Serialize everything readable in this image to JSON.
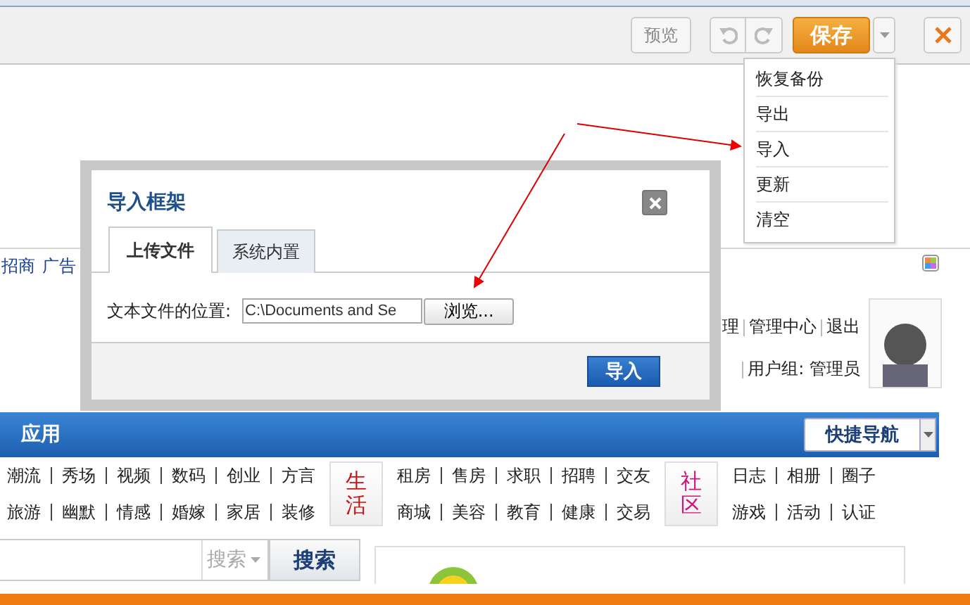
{
  "toolbar": {
    "preview_button": "预览",
    "save_button": "保存"
  },
  "menu": {
    "items": [
      {
        "label": "恢复备份"
      },
      {
        "label": "导出"
      },
      {
        "label": "导入"
      },
      {
        "label": "更新"
      },
      {
        "label": "清空"
      }
    ]
  },
  "header_links": [
    "招商",
    "广告"
  ],
  "user_links": [
    "理",
    "管理中心",
    "退出"
  ],
  "user_group": "用户组: 管理员",
  "nav": {
    "title": "应用",
    "quick_nav": "快捷导航"
  },
  "categories": [
    {
      "kind": "links",
      "rows": [
        [
          "潮流",
          "秀场",
          "视频",
          "数码",
          "创业",
          "方言"
        ],
        [
          "旅游",
          "幽默",
          "情感",
          "婚嫁",
          "家居",
          "装修"
        ]
      ]
    },
    {
      "kind": "tag",
      "label": "生活",
      "color": "#cc1111"
    },
    {
      "kind": "links",
      "rows": [
        [
          "租房",
          "售房",
          "求职",
          "招聘",
          "交友"
        ],
        [
          "商城",
          "美容",
          "教育",
          "健康",
          "交易"
        ]
      ]
    },
    {
      "kind": "tag",
      "label": "社区",
      "color": "#d4127a"
    },
    {
      "kind": "links",
      "rows": [
        [
          "日志",
          "相册",
          "圈子"
        ],
        [
          "游戏",
          "活动",
          "认证"
        ]
      ]
    }
  ],
  "search": {
    "scope": "搜索",
    "button": "搜索"
  },
  "dialog": {
    "title": "导入框架",
    "tabs": [
      {
        "label": "上传文件",
        "selected": true
      },
      {
        "label": "系统内置",
        "selected": false
      }
    ],
    "field_label": "文本文件的位置:",
    "file_field": {
      "value": "C:\\Documents and Se"
    },
    "browse_button": "浏览...",
    "submit_button": "导入"
  }
}
